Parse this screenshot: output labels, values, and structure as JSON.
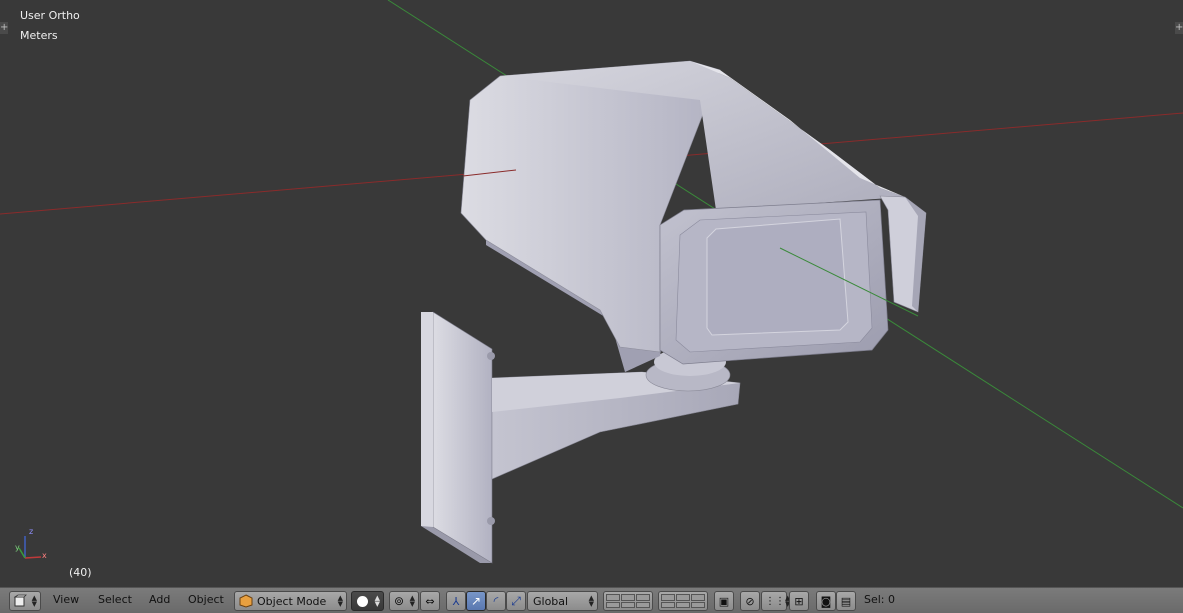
{
  "viewport": {
    "view_label": "User Ortho",
    "units_label": "Meters",
    "frame_label": "(40)",
    "axis_labels": {
      "x": "x",
      "y": "y",
      "z": "z"
    },
    "colors": {
      "background": "#393939",
      "x_axis": "#8a2b2b",
      "y_axis": "#3a8a3a",
      "mesh": "#c9c9d4"
    }
  },
  "header": {
    "menu": {
      "view": "View",
      "select": "Select",
      "add": "Add",
      "object": "Object"
    },
    "mode": "Object Mode",
    "orientation": "Global",
    "selection": "Sel: 0"
  }
}
